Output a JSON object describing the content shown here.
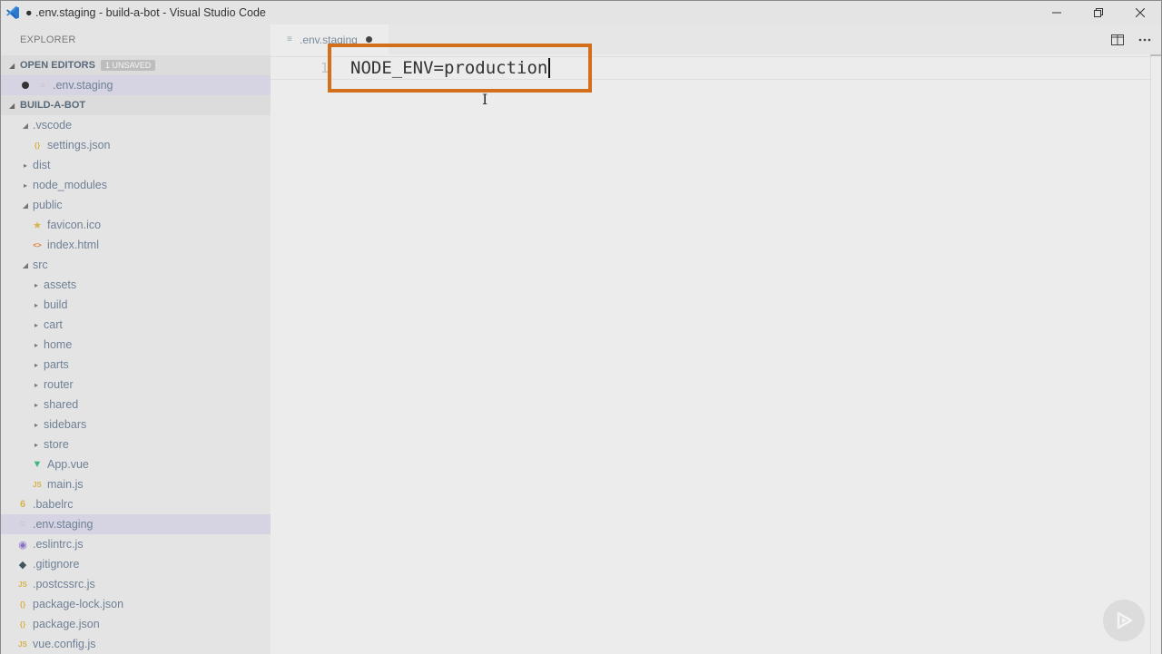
{
  "window": {
    "title": "● .env.staging - build-a-bot - Visual Studio Code",
    "controls": [
      "minimize",
      "restore",
      "close"
    ]
  },
  "sidebar": {
    "title": "EXPLORER",
    "open_editors": {
      "label": "OPEN EDITORS",
      "badge": "1 UNSAVED",
      "items": [
        {
          "label": ".env.staging"
        }
      ]
    },
    "project": {
      "label": "BUILD-A-BOT",
      "tree": [
        {
          "label": ".vscode",
          "kind": "folder-open",
          "depth": 1
        },
        {
          "label": "settings.json",
          "kind": "json",
          "depth": 2
        },
        {
          "label": "dist",
          "kind": "folder",
          "depth": 1
        },
        {
          "label": "node_modules",
          "kind": "folder",
          "depth": 1
        },
        {
          "label": "public",
          "kind": "folder-open",
          "depth": 1
        },
        {
          "label": "favicon.ico",
          "kind": "star",
          "depth": 2
        },
        {
          "label": "index.html",
          "kind": "html",
          "depth": 2
        },
        {
          "label": "src",
          "kind": "folder-open",
          "depth": 1
        },
        {
          "label": "assets",
          "kind": "folder",
          "depth": 2
        },
        {
          "label": "build",
          "kind": "folder",
          "depth": 2
        },
        {
          "label": "cart",
          "kind": "folder",
          "depth": 2
        },
        {
          "label": "home",
          "kind": "folder",
          "depth": 2
        },
        {
          "label": "parts",
          "kind": "folder",
          "depth": 2
        },
        {
          "label": "router",
          "kind": "folder",
          "depth": 2
        },
        {
          "label": "shared",
          "kind": "folder",
          "depth": 2
        },
        {
          "label": "sidebars",
          "kind": "folder",
          "depth": 2
        },
        {
          "label": "store",
          "kind": "folder",
          "depth": 2
        },
        {
          "label": "App.vue",
          "kind": "vue",
          "depth": 2
        },
        {
          "label": "main.js",
          "kind": "js",
          "depth": 2
        },
        {
          "label": ".babelrc",
          "kind": "babel",
          "depth": 0
        },
        {
          "label": ".env.staging",
          "kind": "env",
          "depth": 0,
          "selected": true
        },
        {
          "label": ".eslintrc.js",
          "kind": "eslint",
          "depth": 0
        },
        {
          "label": ".gitignore",
          "kind": "git",
          "depth": 0
        },
        {
          "label": ".postcssrc.js",
          "kind": "js",
          "depth": 0
        },
        {
          "label": "package-lock.json",
          "kind": "json",
          "depth": 0
        },
        {
          "label": "package.json",
          "kind": "json",
          "depth": 0
        },
        {
          "label": "vue.config.js",
          "kind": "js",
          "depth": 0
        }
      ]
    }
  },
  "editor": {
    "tab": {
      "label": ".env.staging",
      "modified": true
    },
    "lines": [
      {
        "number": "1",
        "text": "NODE_ENV=production"
      }
    ]
  },
  "colors": {
    "highlight": "#d36f1a",
    "json_icon": "#d8b24a",
    "js_icon": "#d8b24a",
    "vue_icon": "#41b883",
    "html_icon": "#e37933",
    "eslint_icon": "#8a6fc7",
    "git_icon": "#41535b"
  }
}
